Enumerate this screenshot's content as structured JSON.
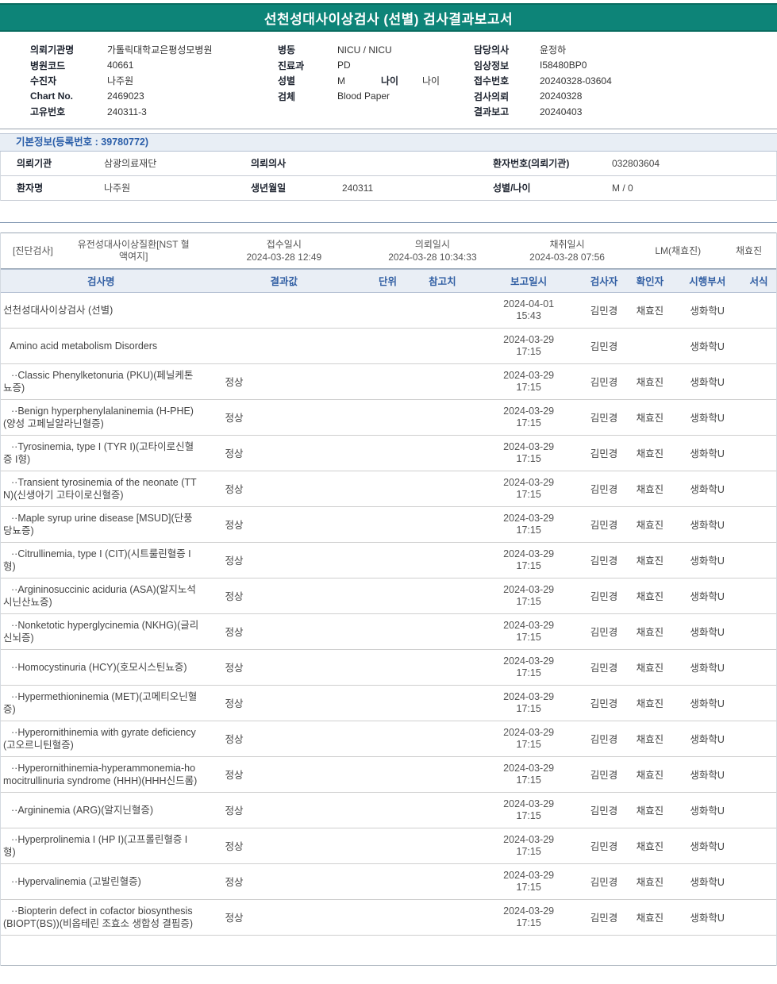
{
  "theme": {
    "header_bg": "#0d8478",
    "section_blue": "#2a5ea9",
    "table_header_blue": "#3360a4"
  },
  "header": {
    "title": "선천성대사이상검사 (선별) 검사결과보고서"
  },
  "info": {
    "left": [
      {
        "label": "의뢰기관명",
        "value": "가톨릭대학교은평성모병원"
      },
      {
        "label": "병원코드",
        "value": "40661"
      },
      {
        "label": "수진자",
        "value": "나주원"
      },
      {
        "label": "Chart No.",
        "value": "2469023"
      },
      {
        "label": "고유번호",
        "value": "240311-3"
      }
    ],
    "middle": [
      {
        "label": "병동",
        "value": "NICU / NICU"
      },
      {
        "label": "진료과",
        "value": "PD"
      },
      {
        "label": "성별",
        "value": "M",
        "label2": "나이",
        "value2": "나이"
      },
      {
        "label": "검체",
        "value": "Blood Paper"
      }
    ],
    "right": [
      {
        "label": "담당의사",
        "value": "윤정하"
      },
      {
        "label": "임상정보",
        "value": "I58480BP0"
      },
      {
        "label": "접수번호",
        "value": "20240328-03604"
      },
      {
        "label": "검사의뢰",
        "value": "20240328"
      },
      {
        "label": "결과보고",
        "value": "20240403"
      }
    ]
  },
  "basic": {
    "section_title": "기본정보(등록번호 : 39780772)",
    "rows": [
      [
        {
          "label": "의뢰기관",
          "value": "삼광의료재단"
        },
        {
          "label": "의뢰의사",
          "value": ""
        },
        {
          "label": "환자번호(의뢰기관)",
          "value": "032803604"
        }
      ],
      [
        {
          "label": "환자명",
          "value": "나주원"
        },
        {
          "label": "생년월일",
          "value": "240311"
        },
        {
          "label": "성별/나이",
          "value": "M / 0"
        }
      ]
    ]
  },
  "order": {
    "type": "[진단검사]",
    "test": "유전성대사이상질환[NST 혈액여지]",
    "receipt_label": "접수일시",
    "receipt_value": "2024-03-28 12:49",
    "request_label": "의뢰일시",
    "request_value": "2024-03-28 10:34:33",
    "collect_label": "채취일시",
    "collect_value": "2024-03-28 07:56",
    "lm": "LM(채효진)",
    "collector": "채효진"
  },
  "results": {
    "headers": [
      "검사명",
      "결과값",
      "단위",
      "참고치",
      "보고일시",
      "검사자",
      "확인자",
      "시행부서",
      "서식"
    ],
    "rows": [
      {
        "level": 0,
        "name": "선천성대사이상검사 (선별)",
        "result": "",
        "unit": "",
        "ref": "",
        "reported": "2024-04-01 15:43",
        "tester": "김민경",
        "confirmer": "채효진",
        "dept": "생화학U",
        "form": ""
      },
      {
        "level": 1,
        "name": "Amino acid metabolism Disorders",
        "result": "",
        "unit": "",
        "ref": "",
        "reported": "2024-03-29 17:15",
        "tester": "김민경",
        "confirmer": "",
        "dept": "생화학U",
        "form": ""
      },
      {
        "level": 2,
        "name": "··Classic Phenylketonuria (PKU)(페닐케톤뇨증)",
        "result": "정상",
        "unit": "",
        "ref": "",
        "reported": "2024-03-29 17:15",
        "tester": "김민경",
        "confirmer": "채효진",
        "dept": "생화학U",
        "form": ""
      },
      {
        "level": 2,
        "name": "··Benign hyperphenylalaninemia (H-PHE)(양성 고페닐알라닌혈증)",
        "result": "정상",
        "unit": "",
        "ref": "",
        "reported": "2024-03-29 17:15",
        "tester": "김민경",
        "confirmer": "채효진",
        "dept": "생화학U",
        "form": ""
      },
      {
        "level": 2,
        "name": "··Tyrosinemia, type I (TYR I)(고타이로신혈증 I형)",
        "result": "정상",
        "unit": "",
        "ref": "",
        "reported": "2024-03-29 17:15",
        "tester": "김민경",
        "confirmer": "채효진",
        "dept": "생화학U",
        "form": ""
      },
      {
        "level": 2,
        "name": "··Transient tyrosinemia of the neonate (TTN)(신생아기 고타이로신혈증)",
        "result": "정상",
        "unit": "",
        "ref": "",
        "reported": "2024-03-29 17:15",
        "tester": "김민경",
        "confirmer": "채효진",
        "dept": "생화학U",
        "form": ""
      },
      {
        "level": 2,
        "name": "··Maple syrup urine disease [MSUD](단풍당뇨증)",
        "result": "정상",
        "unit": "",
        "ref": "",
        "reported": "2024-03-29 17:15",
        "tester": "김민경",
        "confirmer": "채효진",
        "dept": "생화학U",
        "form": ""
      },
      {
        "level": 2,
        "name": "··Citrullinemia, type I (CIT)(시트룰린혈증 I형)",
        "result": "정상",
        "unit": "",
        "ref": "",
        "reported": "2024-03-29 17:15",
        "tester": "김민경",
        "confirmer": "채효진",
        "dept": "생화학U",
        "form": ""
      },
      {
        "level": 2,
        "name": "··Argininosuccinic aciduria (ASA)(알지노석시닌산뇨증)",
        "result": "정상",
        "unit": "",
        "ref": "",
        "reported": "2024-03-29 17:15",
        "tester": "김민경",
        "confirmer": "채효진",
        "dept": "생화학U",
        "form": ""
      },
      {
        "level": 2,
        "name": "··Nonketotic hyperglycinemia (NKHG)(글리신뇌증)",
        "result": "정상",
        "unit": "",
        "ref": "",
        "reported": "2024-03-29 17:15",
        "tester": "김민경",
        "confirmer": "채효진",
        "dept": "생화학U",
        "form": ""
      },
      {
        "level": 2,
        "name": "··Homocystinuria (HCY)(호모시스틴뇨증)",
        "result": "정상",
        "unit": "",
        "ref": "",
        "reported": "2024-03-29 17:15",
        "tester": "김민경",
        "confirmer": "채효진",
        "dept": "생화학U",
        "form": ""
      },
      {
        "level": 2,
        "name": "··Hypermethioninemia (MET)(고메티오닌혈증)",
        "result": "정상",
        "unit": "",
        "ref": "",
        "reported": "2024-03-29 17:15",
        "tester": "김민경",
        "confirmer": "채효진",
        "dept": "생화학U",
        "form": ""
      },
      {
        "level": 2,
        "name": "··Hyperornithinemia with gyrate deficiency(고오르니틴혈증)",
        "result": "정상",
        "unit": "",
        "ref": "",
        "reported": "2024-03-29 17:15",
        "tester": "김민경",
        "confirmer": "채효진",
        "dept": "생화학U",
        "form": ""
      },
      {
        "level": 2,
        "name": "··Hyperornithinemia-hyperammonemia-homocitrullinuria syndrome (HHH)(HHH신드롬)",
        "result": "정상",
        "unit": "",
        "ref": "",
        "reported": "2024-03-29 17:15",
        "tester": "김민경",
        "confirmer": "채효진",
        "dept": "생화학U",
        "form": ""
      },
      {
        "level": 2,
        "name": "··Argininemia (ARG)(알지닌혈증)",
        "result": "정상",
        "unit": "",
        "ref": "",
        "reported": "2024-03-29 17:15",
        "tester": "김민경",
        "confirmer": "채효진",
        "dept": "생화학U",
        "form": ""
      },
      {
        "level": 2,
        "name": "··Hyperprolinemia I (HP I)(고프롤린혈증 I형)",
        "result": "정상",
        "unit": "",
        "ref": "",
        "reported": "2024-03-29 17:15",
        "tester": "김민경",
        "confirmer": "채효진",
        "dept": "생화학U",
        "form": ""
      },
      {
        "level": 2,
        "name": "··Hypervalinemia (고발린혈증)",
        "result": "정상",
        "unit": "",
        "ref": "",
        "reported": "2024-03-29 17:15",
        "tester": "김민경",
        "confirmer": "채효진",
        "dept": "생화학U",
        "form": ""
      },
      {
        "level": 2,
        "name": "··Biopterin defect in cofactor biosynthesis (BIOPT(BS))(비옵테린 조효소 생합성 결핍증)",
        "result": "정상",
        "unit": "",
        "ref": "",
        "reported": "2024-03-29 17:15",
        "tester": "김민경",
        "confirmer": "채효진",
        "dept": "생화학U",
        "form": ""
      }
    ]
  }
}
